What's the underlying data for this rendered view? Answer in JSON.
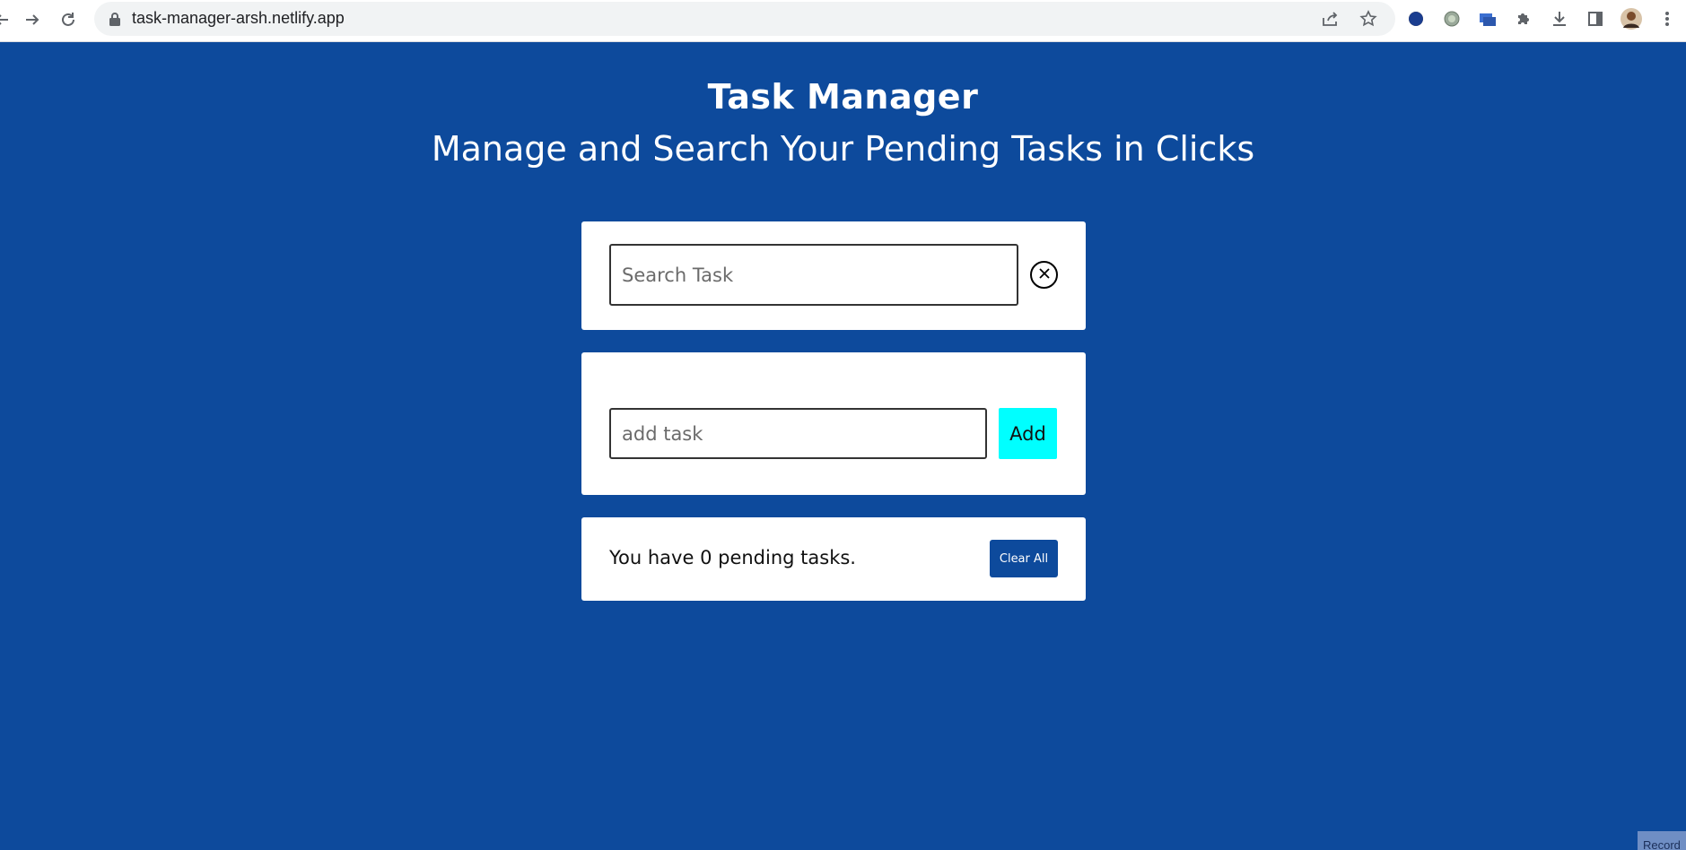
{
  "browser": {
    "url": "task-manager-arsh.netlify.app",
    "icons": [
      "back-icon",
      "forward-icon",
      "reload-icon",
      "lock-icon",
      "share-icon",
      "star-icon",
      "extension-icons",
      "puzzle-icon",
      "download-icon",
      "sidebar-icon",
      "profile-avatar",
      "menu-icon"
    ]
  },
  "header": {
    "title": "Task Manager",
    "subtitle": "Manage and Search Your Pending Tasks in Clicks"
  },
  "search": {
    "placeholder": "Search Task",
    "value": ""
  },
  "add_task": {
    "placeholder": "add task",
    "value": "",
    "button_label": "Add"
  },
  "summary": {
    "pending_text": "You have 0 pending tasks.",
    "clear_all_label": "Clear All"
  },
  "footer": {
    "record_label": "Record"
  },
  "colors": {
    "background": "#0d4a9c",
    "add_button": "#00ffff",
    "clear_all": "#0d4a9c"
  }
}
